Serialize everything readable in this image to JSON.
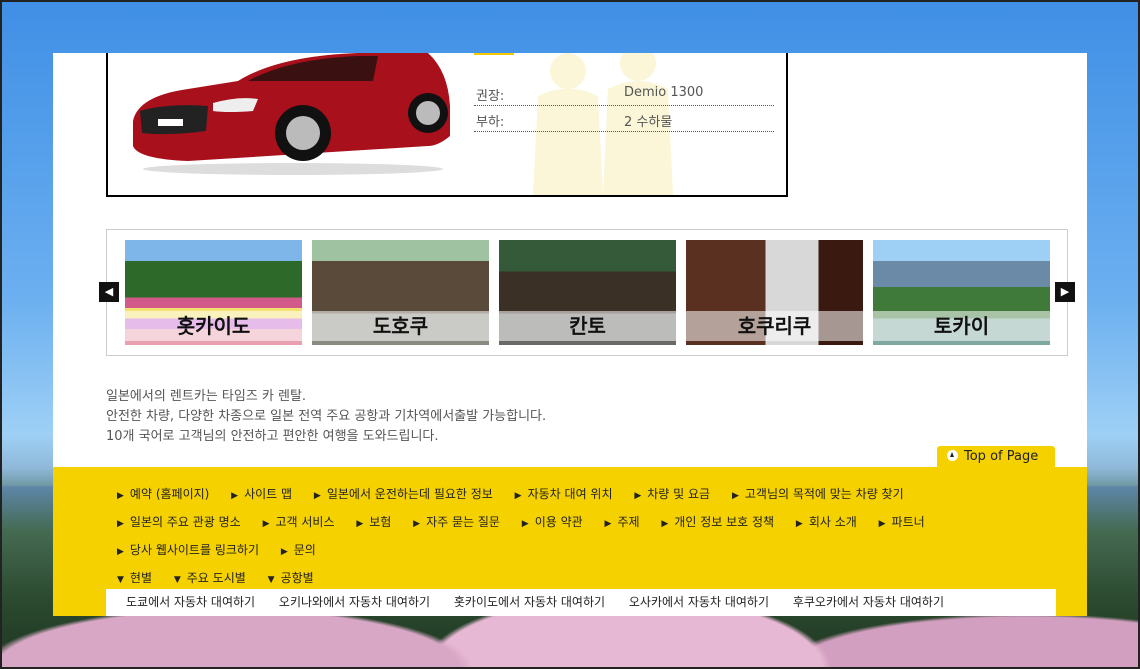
{
  "car": {
    "specs": [
      {
        "label": "권장:",
        "value": "Demio 1300"
      },
      {
        "label": "부하:",
        "value": "2 수하물"
      }
    ]
  },
  "carousel": {
    "prev_icon": "arrow-left-icon",
    "next_icon": "arrow-right-icon",
    "slides": [
      {
        "label": "홋카이도"
      },
      {
        "label": "도호쿠"
      },
      {
        "label": "칸토"
      },
      {
        "label": "호쿠리쿠"
      },
      {
        "label": "토카이"
      }
    ]
  },
  "description": [
    "일본에서의 렌트카는 타임즈 카 렌탈.",
    "안전한 차량, 다양한 차종으로 일본 전역 주요 공항과 기차역에서출발 가능합니다.",
    "10개 국어로 고객님의 안전하고 편안한 여행을 도와드립니다."
  ],
  "top_of_page": "Top of Page",
  "footer": {
    "row1": [
      "예약 (홈페이지)",
      "사이트 맵",
      "일본에서 운전하는데 필요한 정보",
      "자동차 대여 위치",
      "차량 및 요금",
      "고객님의 목적에 맞는 차량 찾기"
    ],
    "row2": [
      "일본의 주요 관광 명소",
      "고객 서비스",
      "보험",
      "자주 묻는 질문",
      "이용 약관",
      "주제",
      "개인 정보 보호 정책",
      "회사 소개",
      "파트너"
    ],
    "row3": [
      "당사 웹사이트를 링크하기",
      "문의"
    ],
    "row4": [
      "현별",
      "주요 도시별",
      "공항별"
    ],
    "cities": [
      "도쿄에서 자동차 대여하기",
      "오키나와에서 자동차 대여하기",
      "홋카이도에서 자동차 대여하기",
      "오사카에서 자동차 대여하기",
      "후쿠오카에서 자동차 대여하기"
    ]
  },
  "colors": {
    "footer_bg": "#f5d100",
    "car": "#a8101c"
  }
}
